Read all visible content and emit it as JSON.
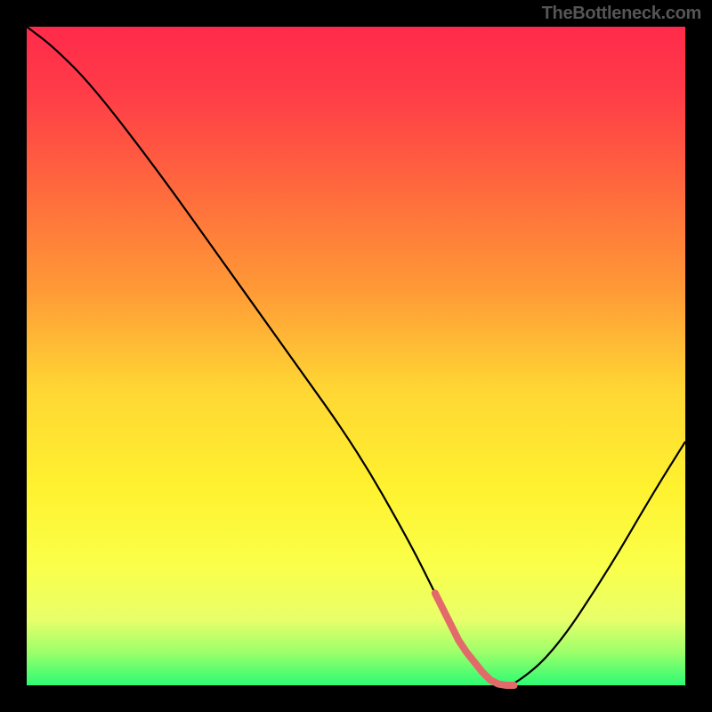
{
  "watermark": "TheBottleneck.com",
  "chart_data": {
    "type": "line",
    "title": "",
    "xlabel": "",
    "ylabel": "",
    "xlim": [
      0,
      100
    ],
    "ylim": [
      0,
      100
    ],
    "series": [
      {
        "name": "bottleneck-curve",
        "x": [
          0,
          4,
          10,
          20,
          30,
          40,
          50,
          58,
          62,
          66,
          70,
          72,
          74,
          80,
          88,
          95,
          100
        ],
        "values": [
          100,
          97,
          91,
          78,
          64,
          50,
          36,
          22,
          14,
          6,
          1,
          0,
          0,
          5,
          17,
          29,
          37
        ]
      }
    ],
    "highlight_segment": {
      "name": "optimal-region",
      "x_range": [
        62,
        74
      ],
      "color": "#e36a6a"
    },
    "gradient_stops": [
      {
        "pos": 0,
        "color": "#ff2a4a"
      },
      {
        "pos": 25,
        "color": "#ff6a3d"
      },
      {
        "pos": 55,
        "color": "#ffd634"
      },
      {
        "pos": 82,
        "color": "#faff4a"
      },
      {
        "pos": 100,
        "color": "#2cfb74"
      }
    ]
  }
}
